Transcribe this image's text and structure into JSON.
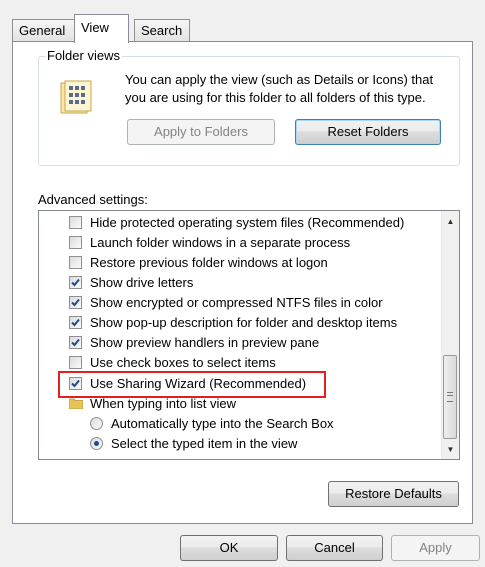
{
  "tabs": [
    {
      "label": "General"
    },
    {
      "label": "View"
    },
    {
      "label": "Search"
    }
  ],
  "folder_views": {
    "title": "Folder views",
    "description": "You can apply the view (such as Details or Icons) that you are using for this folder to all folders of this type.",
    "apply_label": "Apply to Folders",
    "reset_label": "Reset Folders"
  },
  "advanced": {
    "label": "Advanced settings:",
    "items": [
      {
        "type": "checkbox",
        "checked": false,
        "label": "Hide protected operating system files (Recommended)"
      },
      {
        "type": "checkbox",
        "checked": false,
        "label": "Launch folder windows in a separate process"
      },
      {
        "type": "checkbox",
        "checked": false,
        "label": "Restore previous folder windows at logon"
      },
      {
        "type": "checkbox",
        "checked": true,
        "label": "Show drive letters"
      },
      {
        "type": "checkbox",
        "checked": true,
        "label": "Show encrypted or compressed NTFS files in color"
      },
      {
        "type": "checkbox",
        "checked": true,
        "label": "Show pop-up description for folder and desktop items"
      },
      {
        "type": "checkbox",
        "checked": true,
        "label": "Show preview handlers in preview pane"
      },
      {
        "type": "checkbox",
        "checked": false,
        "label": "Use check boxes to select items"
      },
      {
        "type": "checkbox",
        "checked": true,
        "label": "Use Sharing Wizard (Recommended)"
      },
      {
        "type": "group",
        "icon": "folder-icon",
        "label": "When typing into list view"
      },
      {
        "type": "radio",
        "checked": false,
        "label": "Automatically type into the Search Box"
      },
      {
        "type": "radio",
        "checked": true,
        "label": "Select the typed item in the view"
      }
    ],
    "restore_label": "Restore Defaults"
  },
  "footer": {
    "ok_label": "OK",
    "cancel_label": "Cancel",
    "apply_label": "Apply"
  },
  "colors": {
    "highlight_border": "#e02020",
    "check_mark": "#1c4c8c",
    "default_button_border": "#3c7fb1"
  }
}
